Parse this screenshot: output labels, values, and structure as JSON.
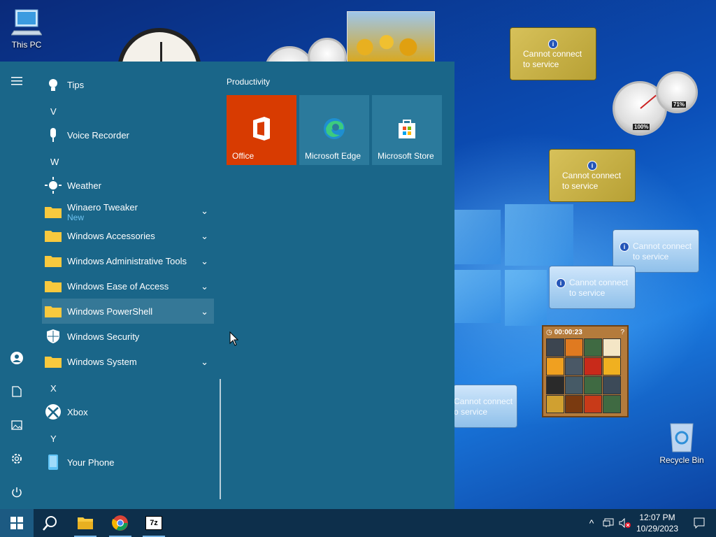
{
  "desktop": {
    "this_pc_label": "This PC",
    "recycle_bin_label": "Recycle Bin"
  },
  "gadgets": {
    "cpu_meter": {
      "cpu_label": "100%",
      "ram_label": "71%"
    },
    "feeds": [
      {
        "line1": "Cannot connect",
        "line2": "to service",
        "style": "gold"
      },
      {
        "line1": "Cannot connect",
        "line2": "to service",
        "style": "gold"
      },
      {
        "line1": "Cannot connect",
        "line2": "to service",
        "style": "blue"
      },
      {
        "line1": "Cannot connect",
        "line2": "to service",
        "style": "blue"
      },
      {
        "line1": "Cannot connect",
        "line2": "o service",
        "style": "blue"
      }
    ],
    "puzzle": {
      "timer": "00:00:23",
      "help": "?"
    }
  },
  "start_menu": {
    "tiles_group_title": "Productivity",
    "tiles": [
      {
        "label": "Office",
        "color": "#d83b01",
        "icon": "office-icon"
      },
      {
        "label": "Microsoft Edge",
        "color": "#2b7a9c",
        "icon": "edge-icon"
      },
      {
        "label": "Microsoft Store",
        "color": "#2b7a9c",
        "icon": "store-icon"
      }
    ],
    "apps": {
      "tips": "Tips",
      "letter_v": "V",
      "voice_recorder": "Voice Recorder",
      "letter_w": "W",
      "weather": "Weather",
      "winaero": "Winaero Tweaker",
      "winaero_badge": "New",
      "accessories": "Windows Accessories",
      "admin_tools": "Windows Administrative Tools",
      "ease": "Windows Ease of Access",
      "powershell": "Windows PowerShell",
      "security": "Windows Security",
      "system": "Windows System",
      "letter_x": "X",
      "xbox": "Xbox",
      "letter_y": "Y",
      "your_phone": "Your Phone"
    }
  },
  "taskbar": {
    "time": "12:07 PM",
    "date": "10/29/2023",
    "seven_zip_label": "7z"
  }
}
